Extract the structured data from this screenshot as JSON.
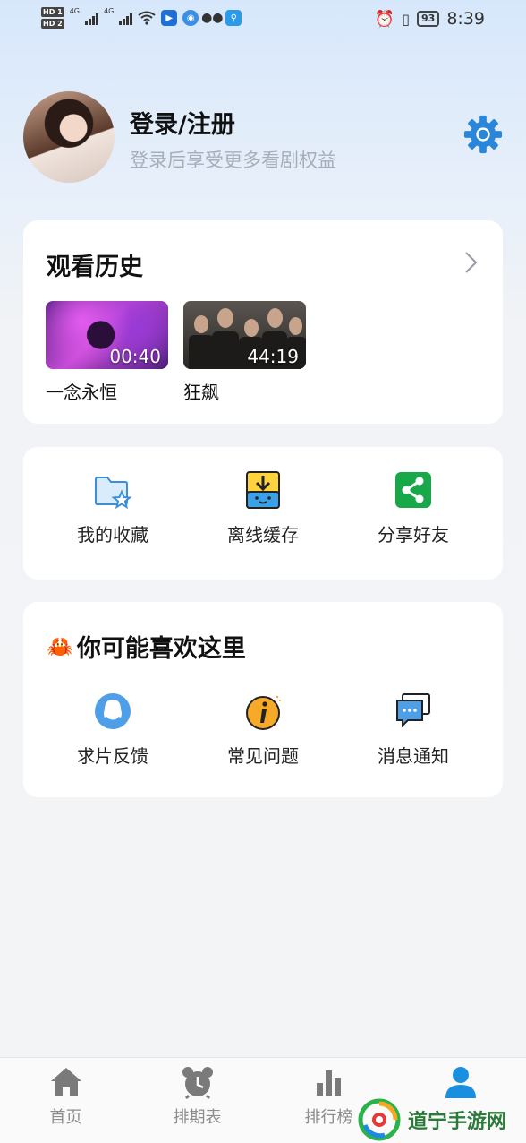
{
  "status_bar": {
    "hd_badges": [
      "HD 1",
      "HD 2"
    ],
    "network": [
      "4G",
      "4G"
    ],
    "battery": "93",
    "time": "8:39"
  },
  "profile": {
    "title": "登录/注册",
    "subtitle": "登录后享受更多看剧权益",
    "settings_icon": "gear-icon"
  },
  "history": {
    "title": "观看历史",
    "items": [
      {
        "label": "一念永恒",
        "time": "00:40"
      },
      {
        "label": "狂飙",
        "time": "44:19"
      }
    ]
  },
  "tools": [
    {
      "label": "我的收藏",
      "icon": "folder-star-icon"
    },
    {
      "label": "离线缓存",
      "icon": "download-icon"
    },
    {
      "label": "分享好友",
      "icon": "share-icon"
    }
  ],
  "like_section": {
    "emoji": "🦀",
    "title": "你可能喜欢这里",
    "items": [
      {
        "label": "求片反馈",
        "icon": "qq-penguin-icon"
      },
      {
        "label": "常见问题",
        "icon": "info-icon"
      },
      {
        "label": "消息通知",
        "icon": "message-icon"
      }
    ]
  },
  "bottom_nav": [
    {
      "label": "首页",
      "icon": "home-icon"
    },
    {
      "label": "排期表",
      "icon": "alarm-clock-icon"
    },
    {
      "label": "排行榜",
      "icon": "bar-chart-icon"
    },
    {
      "label": "",
      "icon": "user-icon"
    }
  ],
  "watermark": {
    "text": "道宁手游网"
  },
  "colors": {
    "accent": "#1a8fe0",
    "gear": "#2a86d8",
    "share_green": "#18a84a",
    "nav_inactive": "#8c8c8c"
  }
}
